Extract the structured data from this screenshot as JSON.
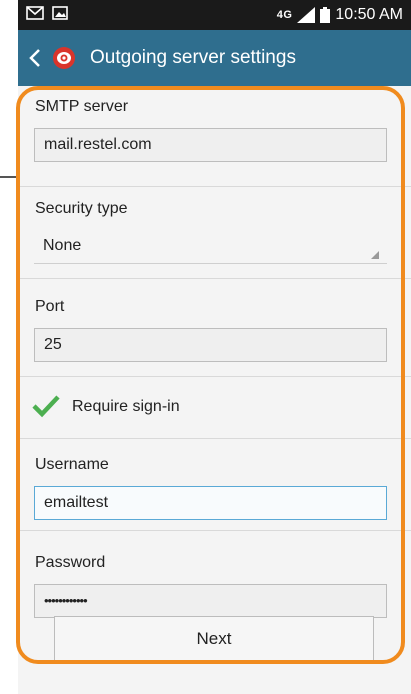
{
  "status_bar": {
    "network": "4G",
    "time": "10:50 AM"
  },
  "app_bar": {
    "title": "Outgoing server settings",
    "icon": "email-app-icon"
  },
  "form": {
    "smtp": {
      "label": "SMTP server",
      "value": "mail.restel.com"
    },
    "security": {
      "label": "Security type",
      "value": "None"
    },
    "port": {
      "label": "Port",
      "value": "25"
    },
    "require_signin": {
      "label": "Require sign-in",
      "checked": true
    },
    "username": {
      "label": "Username",
      "value": "emailtest"
    },
    "password": {
      "label": "Password",
      "value": "••••••••••••"
    }
  },
  "next_label": "Next",
  "colors": {
    "app_bar": "#2f6e8e",
    "highlight": "#f08b1e",
    "checkmark": "#4caf50",
    "status_bar": "#1a1a1a"
  }
}
